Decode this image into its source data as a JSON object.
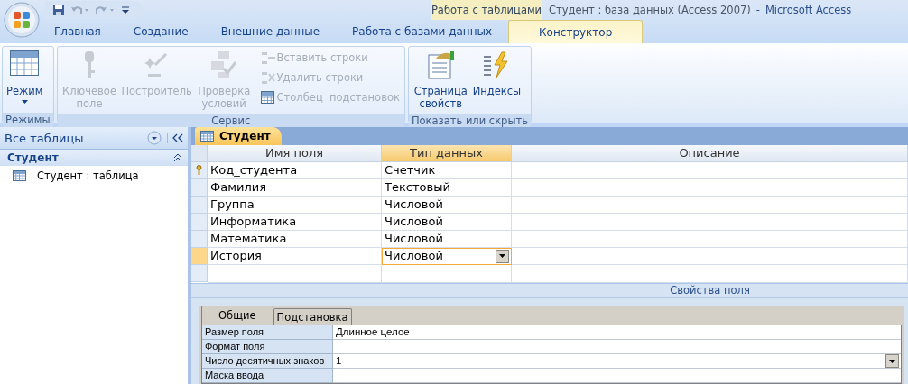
{
  "window": {
    "title": "Студент : база данных (Access 2007)",
    "separator": "-",
    "app": "Microsoft Access"
  },
  "context_tab_group": "Работа с таблицами",
  "tabs": [
    {
      "label": "Главная",
      "selected": false
    },
    {
      "label": "Создание",
      "selected": false
    },
    {
      "label": "Внешние данные",
      "selected": false
    },
    {
      "label": "Работа с базами данных",
      "selected": false
    },
    {
      "label": "Конструктор",
      "selected": true
    }
  ],
  "ribbon": {
    "groups": [
      {
        "label": "Режимы",
        "buttons": [
          {
            "kind": "large",
            "label": "Режим",
            "disabled": false,
            "dropdown": true
          }
        ]
      },
      {
        "label": "Сервис",
        "buttons": [
          {
            "kind": "large",
            "label": "Ключевое поле",
            "disabled": true
          },
          {
            "kind": "large",
            "label": "Построитель",
            "disabled": true
          },
          {
            "kind": "large",
            "label": "Проверка условий",
            "disabled": true
          },
          {
            "kind": "small",
            "label": "Вставить строки",
            "disabled": true
          },
          {
            "kind": "small",
            "label": "Удалить строки",
            "disabled": true
          },
          {
            "kind": "small",
            "label": "Столбец  подстановок",
            "disabled": true
          }
        ]
      },
      {
        "label": "Показать или скрыть",
        "buttons": [
          {
            "kind": "large",
            "label": "Страница свойств",
            "disabled": false
          },
          {
            "kind": "large",
            "label": "Индексы",
            "disabled": false
          }
        ]
      }
    ]
  },
  "nav_pane": {
    "title": "Все таблицы",
    "groups": [
      {
        "label": "Студент",
        "expanded": true,
        "items": [
          {
            "label": "Студент : таблица"
          }
        ]
      }
    ]
  },
  "document_tab": {
    "label": "Студент",
    "selected": true
  },
  "design_grid": {
    "columns": [
      "Имя поля",
      "Тип данных",
      "Описание"
    ],
    "rows": [
      {
        "name": "Код_студента",
        "type": "Счетчик",
        "primary_key": true,
        "selected": false
      },
      {
        "name": "Фамилия",
        "type": "Текстовый",
        "primary_key": false,
        "selected": false
      },
      {
        "name": "Группа",
        "type": "Числовой",
        "primary_key": false,
        "selected": false
      },
      {
        "name": "Информатика",
        "type": "Числовой",
        "primary_key": false,
        "selected": false
      },
      {
        "name": "Математика",
        "type": "Числовой",
        "primary_key": false,
        "selected": false
      },
      {
        "name": "История",
        "type": "Числовой",
        "primary_key": false,
        "selected": true
      }
    ]
  },
  "field_properties": {
    "title": "Свойства поля",
    "tabs": [
      {
        "label": "Общие",
        "selected": true
      },
      {
        "label": "Подстановка",
        "selected": false
      }
    ],
    "rows": [
      {
        "label": "Размер поля",
        "value": "Длинное целое",
        "dropdown": false
      },
      {
        "label": "Формат поля",
        "value": "",
        "dropdown": false
      },
      {
        "label": "Число десятичных знаков",
        "value": "1",
        "dropdown": true
      },
      {
        "label": "Маска ввода",
        "value": "",
        "dropdown": false
      }
    ]
  }
}
